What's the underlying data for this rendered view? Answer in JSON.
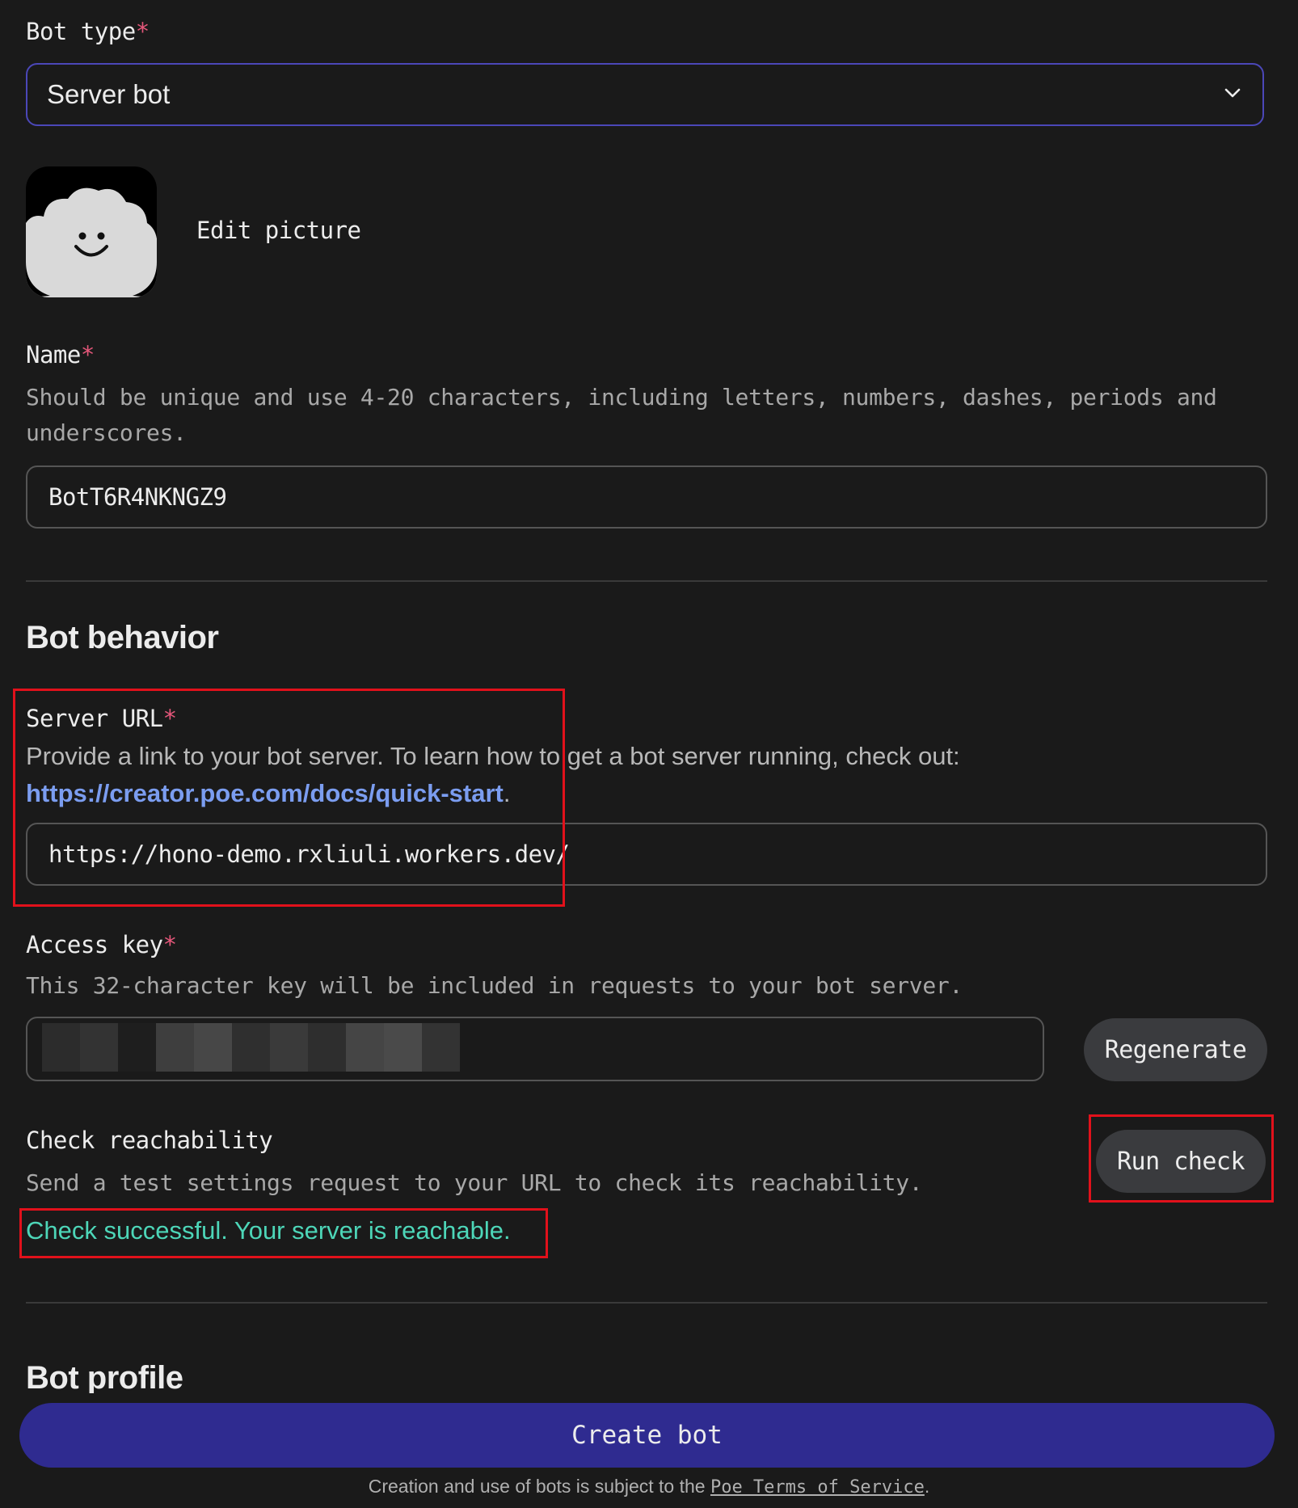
{
  "bot_type": {
    "label": "Bot type",
    "required_mark": "*",
    "selected_value": "Server bot",
    "chevron_icon": "chevron-down-icon"
  },
  "picture": {
    "edit_label": "Edit picture",
    "avatar_icon": "smiling-cloud-avatar"
  },
  "name": {
    "label": "Name",
    "required_mark": "*",
    "hint_line1": "Should be unique and use 4-20 characters, including letters, numbers, dashes, periods and",
    "hint_line2": "underscores.",
    "value": "BotT6R4NKNGZ9"
  },
  "bot_behavior": {
    "title": "Bot behavior",
    "server_url": {
      "label": "Server URL",
      "required_mark": "*",
      "hint": "Provide a link to your bot server. To learn how to get a bot server running, check out:",
      "link": "https://creator.poe.com/docs/quick-start",
      "link_suffix": ".",
      "value": "https://hono-demo.rxliuli.workers.dev/"
    },
    "access_key": {
      "label": "Access key",
      "required_mark": "*",
      "hint": "This 32-character key will be included in requests to your bot server.",
      "regenerate_label": "Regenerate"
    },
    "reachability": {
      "label": "Check reachability",
      "hint": "Send a test settings request to your URL to check its reachability.",
      "run_label": "Run check",
      "result": "Check successful. Your server is reachable."
    }
  },
  "bot_profile": {
    "title": "Bot profile"
  },
  "footer": {
    "create_label": "Create bot",
    "terms_prefix": "Creation and use of bots is subject to the ",
    "terms_link": "Poe Terms of Service",
    "terms_suffix": "."
  },
  "colors": {
    "background": "#1a1a1a",
    "accent": "#2f2b90",
    "select_border": "#4b47b8",
    "required": "#e5577a",
    "link": "#7b9df0",
    "success": "#4dd6b8",
    "annotation": "#e1111b"
  }
}
